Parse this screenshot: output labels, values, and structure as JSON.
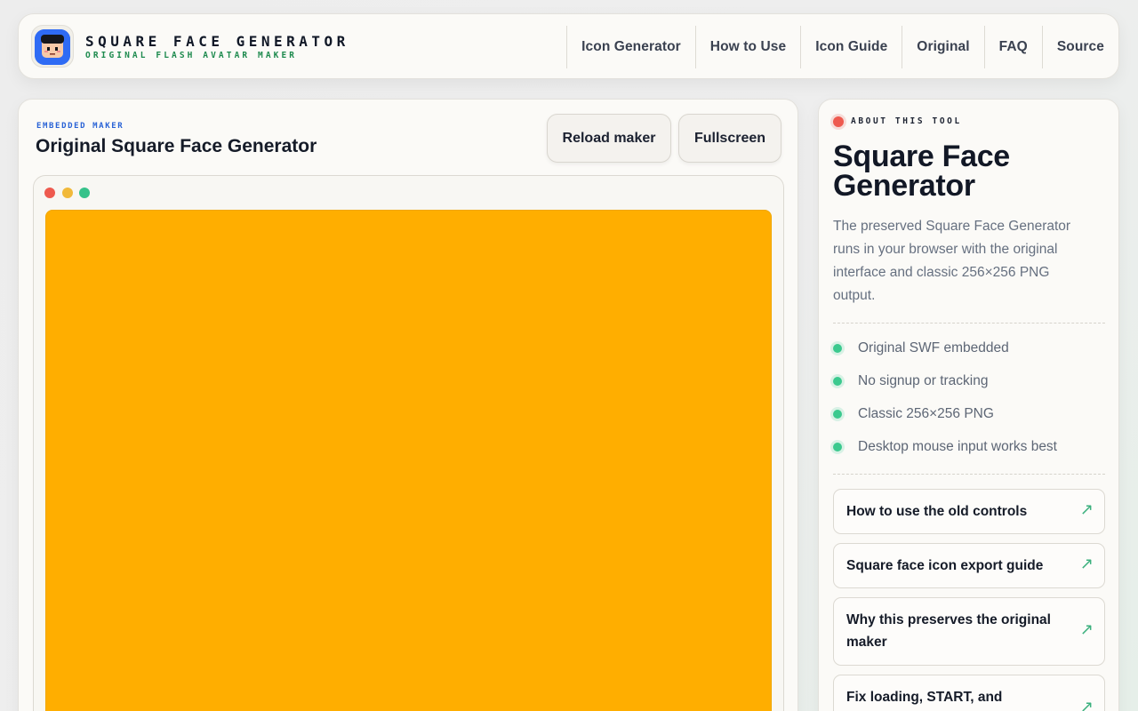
{
  "header": {
    "brand_title": "SQUARE FACE GENERATOR",
    "brand_subtitle": "ORIGINAL FLASH AVATAR MAKER",
    "nav": [
      {
        "label": "Icon Generator"
      },
      {
        "label": "How to Use"
      },
      {
        "label": "Icon Guide"
      },
      {
        "label": "Original"
      },
      {
        "label": "FAQ"
      },
      {
        "label": "Source"
      }
    ]
  },
  "main": {
    "eyebrow": "EMBEDDED MAKER",
    "title": "Original Square Face Generator",
    "reload_label": "Reload maker",
    "fullscreen_label": "Fullscreen",
    "stage_color": "#ffae00"
  },
  "sidebar": {
    "eyebrow": "ABOUT THIS TOOL",
    "title": "Square Face Generator",
    "description": "The preserved Square Face Generator runs in your browser with the original interface and classic 256×256 PNG output.",
    "features": [
      "Original SWF embedded",
      "No signup or tracking",
      "Classic 256×256 PNG",
      "Desktop mouse input works best"
    ],
    "links": [
      {
        "label": "How to use the old controls"
      },
      {
        "label": "Square face icon export guide"
      },
      {
        "label": "Why this preserves the original maker"
      },
      {
        "label": "Fix loading, START, and"
      }
    ],
    "arrow_icon": "arrow-up-right-icon"
  },
  "colors": {
    "accent_blue": "#2a63d6",
    "accent_green": "#3bc98e",
    "status_red": "#ee5a4f",
    "stage_orange": "#ffae00"
  }
}
